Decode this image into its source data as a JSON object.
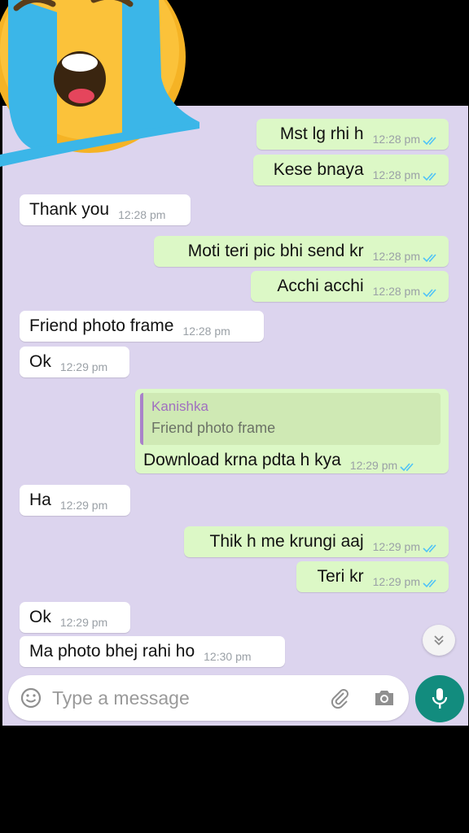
{
  "chat": {
    "messages": [
      {
        "dir": "out",
        "text": "Mst lg rhi h",
        "time": "12:28 pm"
      },
      {
        "dir": "out",
        "text": "Kese bnaya",
        "time": "12:28 pm"
      },
      {
        "dir": "in",
        "text": "Thank you",
        "time": "12:28 pm"
      },
      {
        "dir": "out",
        "text": "Moti teri pic bhi send kr",
        "time": "12:28 pm"
      },
      {
        "dir": "out",
        "text": "Acchi acchi",
        "time": "12:28 pm"
      },
      {
        "dir": "in",
        "text": "Friend photo frame",
        "time": "12:28 pm"
      },
      {
        "dir": "in",
        "text": "Ok",
        "time": "12:29 pm"
      },
      {
        "dir": "out",
        "text": "Download krna pdta h kya",
        "time": "12:29 pm",
        "quote": {
          "name": "Kanishka",
          "text": "Friend photo frame"
        }
      },
      {
        "dir": "in",
        "text": "Ha",
        "time": "12:29 pm"
      },
      {
        "dir": "out",
        "text": "Thik h me krungi aaj",
        "time": "12:29 pm"
      },
      {
        "dir": "out",
        "text": "Teri kr",
        "time": "12:29 pm"
      },
      {
        "dir": "in",
        "text": "Ok",
        "time": "12:29 pm"
      },
      {
        "dir": "in",
        "text": "Ma photo bhej rahi ho",
        "time": "12:30 pm"
      }
    ]
  },
  "input": {
    "placeholder": "Type a message"
  },
  "icons": {
    "emoji": "emoji-icon",
    "attach": "paperclip-icon",
    "camera": "camera-icon",
    "mic": "mic-icon",
    "scroll": "chevron-double-down-icon",
    "ticks": "double-check-icon",
    "sticker": "loudly-crying-face-emoji"
  },
  "colors": {
    "chat_background": "#dcd4ee",
    "outgoing_bubble": "#dcf8c6",
    "incoming_bubble": "#ffffff",
    "read_ticks": "#4fc3f7",
    "mic_button": "#128c7e",
    "quote_name": "#a06fc0"
  }
}
